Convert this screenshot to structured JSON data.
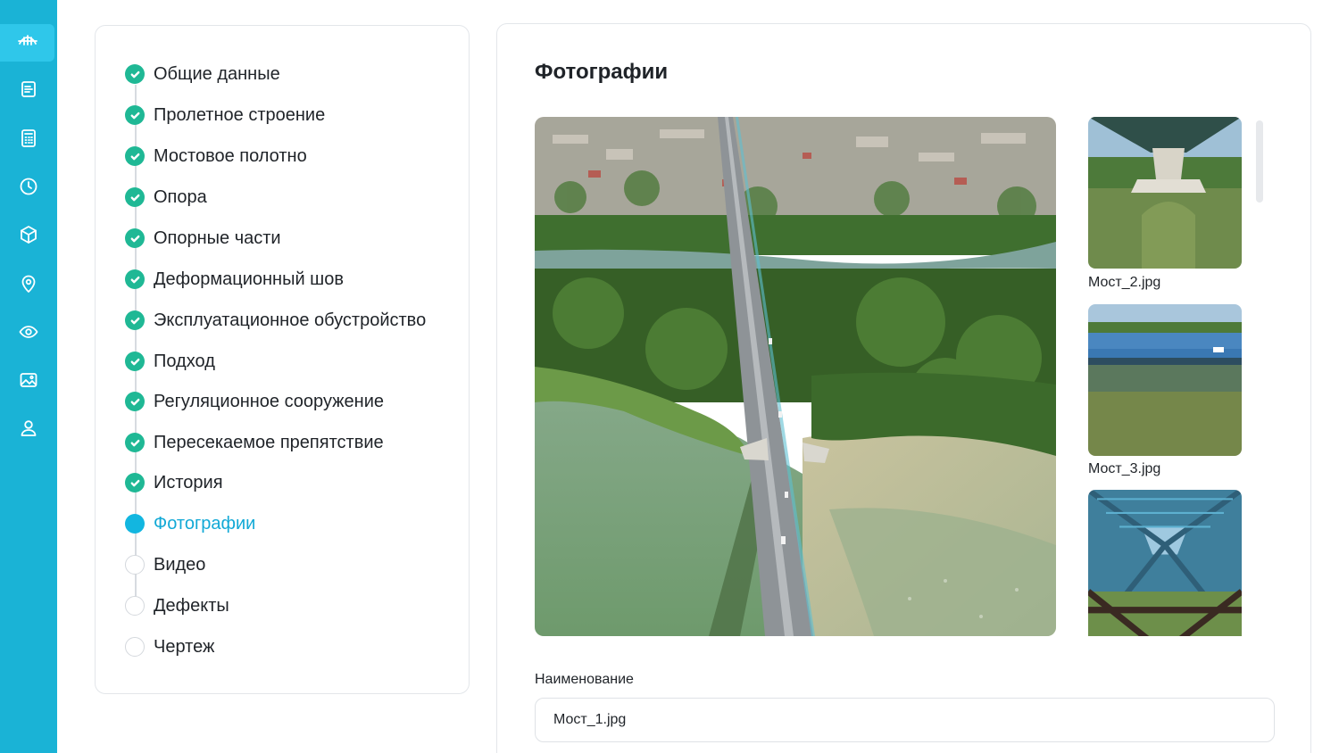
{
  "sidebar": {
    "items": [
      {
        "icon": "bridge-icon",
        "active": true
      },
      {
        "icon": "document-icon",
        "active": false
      },
      {
        "icon": "calculator-icon",
        "active": false
      },
      {
        "icon": "clock-icon",
        "active": false
      },
      {
        "icon": "cube-icon",
        "active": false
      },
      {
        "icon": "map-pin-icon",
        "active": false
      },
      {
        "icon": "eye-icon",
        "active": false
      },
      {
        "icon": "image-icon",
        "active": false
      },
      {
        "icon": "user-icon",
        "active": false
      }
    ]
  },
  "steps": [
    {
      "label": "Общие данные",
      "status": "done"
    },
    {
      "label": "Пролетное строение",
      "status": "done"
    },
    {
      "label": "Мостовое полотно",
      "status": "done"
    },
    {
      "label": "Опора",
      "status": "done"
    },
    {
      "label": "Опорные части",
      "status": "done"
    },
    {
      "label": "Деформационный шов",
      "status": "done"
    },
    {
      "label": "Эксплуатационное обустройство",
      "status": "done"
    },
    {
      "label": "Подход",
      "status": "done"
    },
    {
      "label": "Регуляционное сооружение",
      "status": "done"
    },
    {
      "label": "Пересекаемое препятствие",
      "status": "done"
    },
    {
      "label": "История",
      "status": "done"
    },
    {
      "label": "Фотографии",
      "status": "current"
    },
    {
      "label": "Видео",
      "status": "todo"
    },
    {
      "label": "Дефекты",
      "status": "todo"
    },
    {
      "label": "Чертеж",
      "status": "todo"
    }
  ],
  "photos": {
    "title": "Фотографии",
    "thumbnails": [
      {
        "name": "Мост_2.jpg"
      },
      {
        "name": "Мост_3.jpg"
      },
      {
        "name": ""
      }
    ],
    "name_field": {
      "label": "Наименование",
      "value": "Мост_1.jpg"
    }
  },
  "colors": {
    "accent": "#1ab3d6",
    "done": "#1fb895",
    "current": "#12b6e0"
  }
}
